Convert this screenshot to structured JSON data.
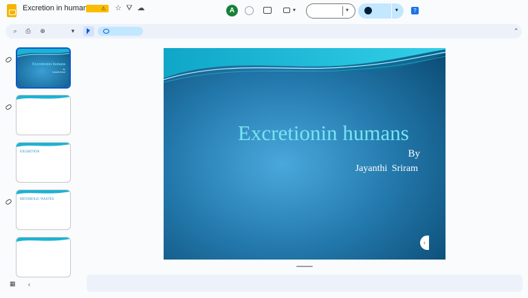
{
  "header": {
    "title": "Excretion in humans",
    "warning_icon": "warning-icon",
    "star_icon": "star-icon",
    "move_icon": "move-to-drive-icon",
    "cloud_icon": "cloud-status-icon",
    "collaborator_initial": "A",
    "gemini_label": "?"
  },
  "toolbar": {
    "search_icon": "search-icon",
    "print_icon": "print-icon",
    "zoom_icon": "zoom-icon",
    "zoom_caret": "▾",
    "collapse_caret": "⌃"
  },
  "slides": [
    {
      "title": "Excretionin humans",
      "by": "By",
      "author": "Jayanthi Sriram"
    },
    {
      "text": ""
    },
    {
      "text": "EXCRETION"
    },
    {
      "text": "METABOLIC WASTES"
    },
    {
      "text": ""
    }
  ],
  "slide_main": {
    "title": "Excretionin humans",
    "by": "By",
    "author": "Jayanthi  Sriram"
  },
  "colors": {
    "slide_bg": "#2c7fb0",
    "title_color": "#74e6f4",
    "accent": "#0b57d0"
  }
}
